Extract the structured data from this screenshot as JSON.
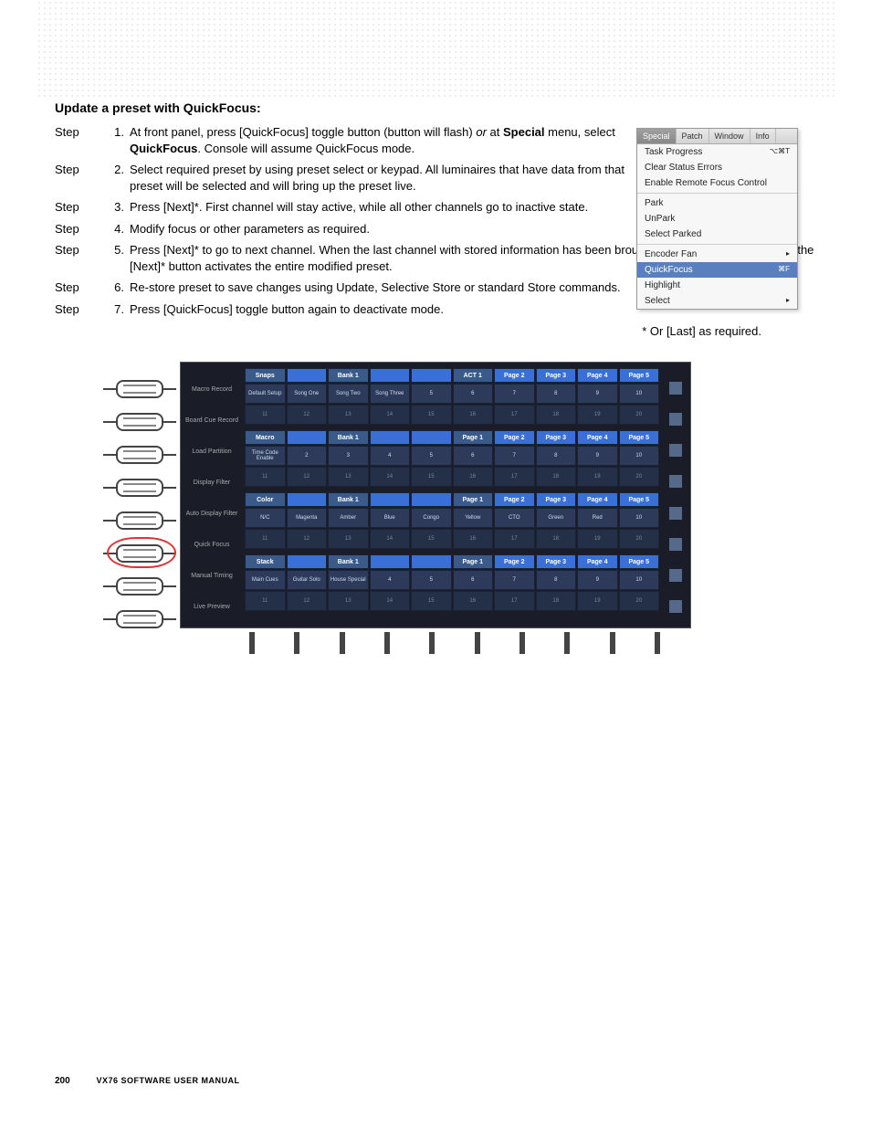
{
  "title": "Update a preset with QuickFocus:",
  "step_label": "Step",
  "steps": [
    {
      "n": "1.",
      "pre": "At front panel, press [QuickFocus] toggle button (button will flash) ",
      "ital": "or",
      "mid": " at ",
      "bold1": "Special",
      "after1": " menu, select ",
      "bold2": "QuickFocus",
      "after2": ".  Console will assume QuickFocus mode.",
      "wide": false
    },
    {
      "n": "2.",
      "text": "Select required preset by using preset select or keypad.  All luminaires that have data from that preset will be selected and will bring up the preset live.",
      "wide": false
    },
    {
      "n": "3.",
      "text": "Press [Next]*.  First channel will stay active, while all other channels go to inactive state.",
      "wide": false
    },
    {
      "n": "4.",
      "text": "Modify focus or other parameters as required.",
      "wide": false
    },
    {
      "n": "5.",
      "text": "Press [Next]* to go to next channel.  When the last channel with stored information has been brought up and adjusted, pressing the [Next]* button activates the entire modified preset.",
      "wide": true
    },
    {
      "n": "6.",
      "text": "Re-store preset to save changes using Update, Selective Store or standard Store commands.",
      "wide": true
    },
    {
      "n": "7.",
      "text": "Press [QuickFocus] toggle button again to deactivate mode.",
      "wide": true
    }
  ],
  "footnote": "* Or [Last] as required.",
  "menu": {
    "tabs": [
      "Special",
      "Patch",
      "Window",
      "Info"
    ],
    "items": [
      {
        "t": "Task Progress",
        "s": "⌥⌘T"
      },
      {
        "t": "Clear Status Errors",
        "s": ""
      },
      {
        "t": "Enable Remote Focus Control",
        "s": ""
      },
      {
        "sep": true
      },
      {
        "t": "Park",
        "s": ""
      },
      {
        "t": "UnPark",
        "s": ""
      },
      {
        "t": "Select Parked",
        "s": ""
      },
      {
        "sep": true
      },
      {
        "t": "Encoder Fan",
        "s": "▸"
      },
      {
        "t": "QuickFocus",
        "s": "⌘F",
        "hl": true
      },
      {
        "t": "Highlight",
        "s": ""
      },
      {
        "t": "Select",
        "s": "▸"
      }
    ]
  },
  "side_labels": [
    "Macro Record",
    "Board Cue Record",
    "Load Partition",
    "Display Filter",
    "Auto Display Filter",
    "Quick Focus",
    "Manual Timing",
    "Live Preview"
  ],
  "panel": {
    "groups": [
      {
        "hdr": [
          "Snaps",
          "",
          "Bank 1",
          "",
          "",
          "ACT 1",
          "Page 2",
          "Page 3",
          "Page 4",
          "Page 5"
        ],
        "r1": [
          "Default Setup",
          "Song One",
          "Song Two",
          "Song Three",
          "5",
          "6",
          "7",
          "8",
          "9",
          "10"
        ],
        "r2": [
          "11",
          "12",
          "13",
          "14",
          "15",
          "16",
          "17",
          "18",
          "19",
          "20"
        ]
      },
      {
        "hdr": [
          "Macro",
          "",
          "Bank 1",
          "",
          "",
          "Page 1",
          "Page 2",
          "Page 3",
          "Page 4",
          "Page 5"
        ],
        "r1": [
          "Time Code Enable",
          "2",
          "3",
          "4",
          "5",
          "6",
          "7",
          "8",
          "9",
          "10"
        ],
        "r2": [
          "11",
          "12",
          "13",
          "14",
          "15",
          "16",
          "17",
          "18",
          "19",
          "20"
        ]
      },
      {
        "hdr": [
          "Color",
          "",
          "Bank 1",
          "",
          "",
          "Page 1",
          "Page 2",
          "Page 3",
          "Page 4",
          "Page 5"
        ],
        "r1": [
          "N/C",
          "Magenta",
          "Amber",
          "Blue",
          "Congo",
          "Yellow",
          "CTO",
          "Green",
          "Red",
          "10"
        ],
        "r2": [
          "11",
          "12",
          "13",
          "14",
          "15",
          "16",
          "17",
          "18",
          "19",
          "20"
        ]
      },
      {
        "hdr": [
          "Stack",
          "",
          "Bank 1",
          "",
          "",
          "Page 1",
          "Page 2",
          "Page 3",
          "Page 4",
          "Page 5"
        ],
        "r1": [
          "Main Cues",
          "Guitar Solo",
          "House Special",
          "4",
          "5",
          "6",
          "7",
          "8",
          "9",
          "10"
        ],
        "r2": [
          "11",
          "12",
          "13",
          "14",
          "15",
          "16",
          "17",
          "18",
          "19",
          "20"
        ]
      }
    ]
  },
  "footer": {
    "page": "200",
    "manual": "VX76 SOFTWARE USER MANUAL"
  }
}
